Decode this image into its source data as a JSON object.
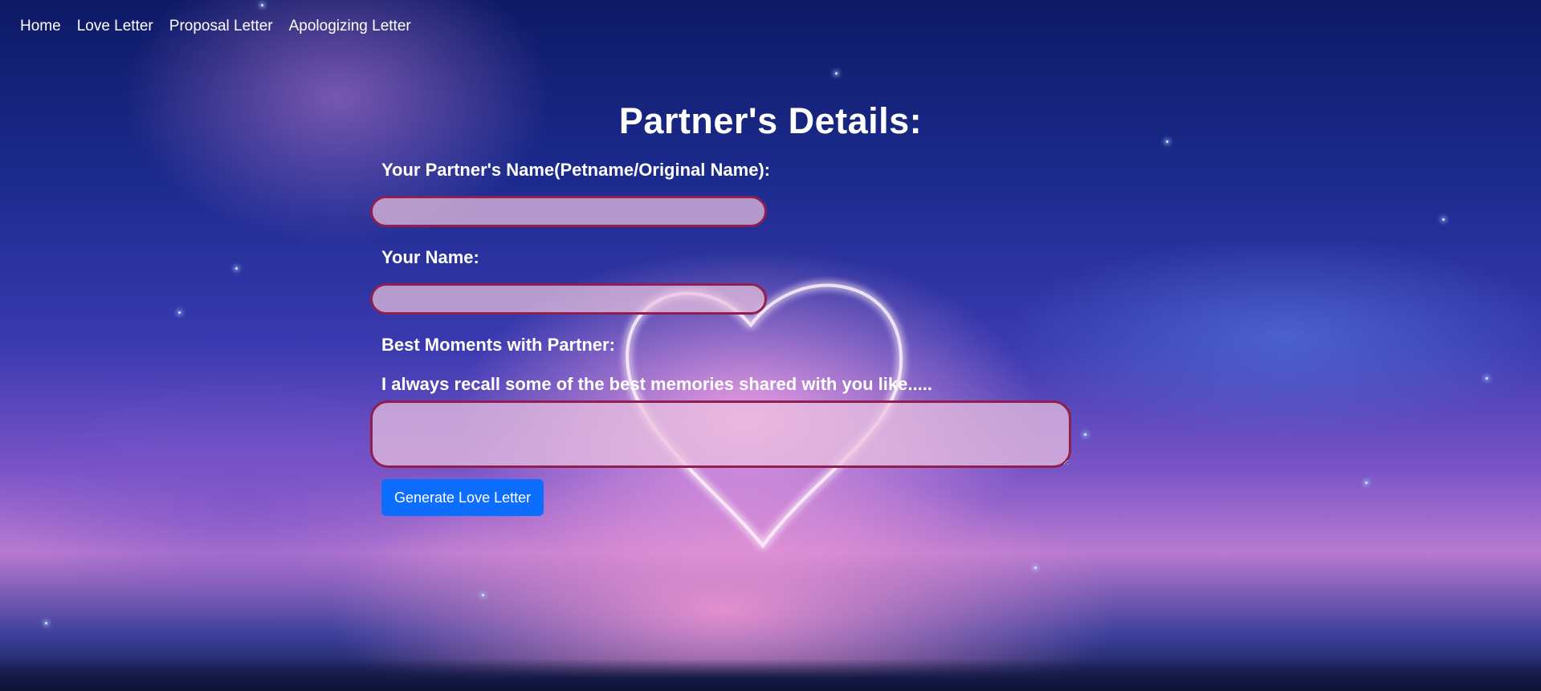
{
  "nav": {
    "items": [
      {
        "label": "Home"
      },
      {
        "label": "Love Letter"
      },
      {
        "label": "Proposal Letter"
      },
      {
        "label": "Apologizing Letter"
      }
    ]
  },
  "form": {
    "title": "Partner's Details:",
    "partner_name_label": "Your Partner's Name(Petname/Original Name):",
    "partner_name_value": "",
    "your_name_label": "Your Name:",
    "your_name_value": "",
    "moments_label": "Best Moments with Partner:",
    "moments_prompt": "I always recall some of the best memories shared with you like.....",
    "moments_value": "",
    "submit_label": "Generate Love Letter"
  },
  "colors": {
    "button": "#0d6efd",
    "field_border": "#8e1f4f",
    "field_fill": "#ecc4e0"
  },
  "background_icon": "glowing-heart-icon"
}
